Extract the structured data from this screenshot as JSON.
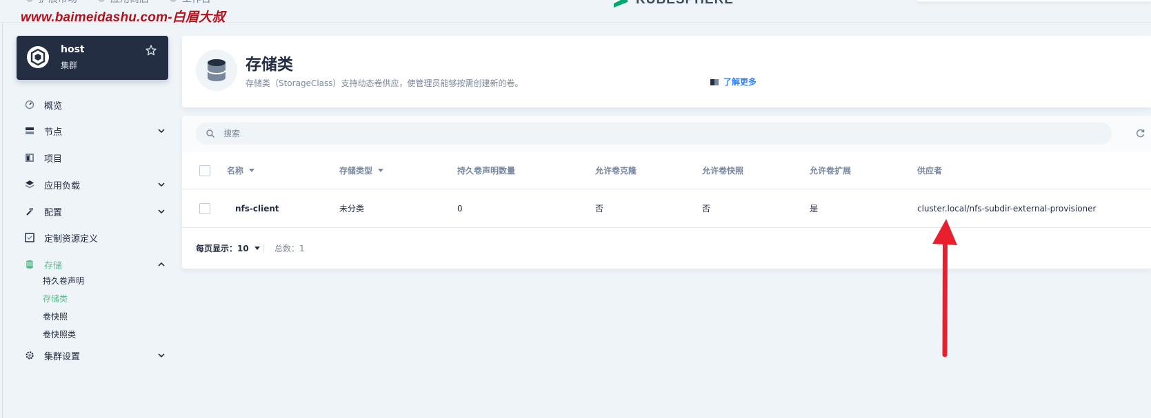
{
  "topbar": {
    "nav": [
      "扩展市场",
      "应用商店",
      "工作台"
    ],
    "watermark": "www.baimeidashu.com-白眉大叔",
    "brand": "KUBESPHERE"
  },
  "cluster": {
    "name": "host",
    "type": "集群"
  },
  "sidebar": {
    "items": [
      {
        "label": "概览",
        "icon": "dashboard-icon",
        "expandable": false
      },
      {
        "label": "节点",
        "icon": "server-icon",
        "expandable": true
      },
      {
        "label": "项目",
        "icon": "project-icon",
        "expandable": false
      },
      {
        "label": "应用负载",
        "icon": "layers-icon",
        "expandable": true
      },
      {
        "label": "配置",
        "icon": "hammer-icon",
        "expandable": true
      },
      {
        "label": "定制资源定义",
        "icon": "crd-icon",
        "expandable": false
      },
      {
        "label": "存储",
        "icon": "database-icon",
        "expandable": true,
        "expanded": true,
        "active": true
      },
      {
        "label": "集群设置",
        "icon": "gear-icon",
        "expandable": true
      }
    ],
    "storage_children": [
      "持久卷声明",
      "存储类",
      "卷快照",
      "卷快照类"
    ],
    "active_child": "存储类"
  },
  "banner": {
    "title": "存储类",
    "description": "存储类（StorageClass）支持动态卷供应，使管理员能够按需创建新的卷。",
    "learn_more": "了解更多"
  },
  "search": {
    "placeholder": "搜索"
  },
  "table": {
    "columns": [
      "名称",
      "存储类型",
      "持久卷声明数量",
      "允许卷克隆",
      "允许卷快照",
      "允许卷扩展",
      "供应者"
    ],
    "rows": [
      {
        "name": "nfs-client",
        "storage_type": "未分类",
        "pvc_count": "0",
        "allow_clone": "否",
        "allow_snapshot": "否",
        "allow_expand": "是",
        "provisioner": "cluster.local/nfs-subdir-external-provisioner"
      }
    ]
  },
  "pagination": {
    "page_size_label": "每页显示：",
    "page_size": "10",
    "total": "总数：1"
  },
  "colors": {
    "accent": "#55bc8a",
    "dark": "#242e42",
    "link": "#3385ff",
    "annotation": "#e8202e",
    "watermark": "#b5111c"
  }
}
